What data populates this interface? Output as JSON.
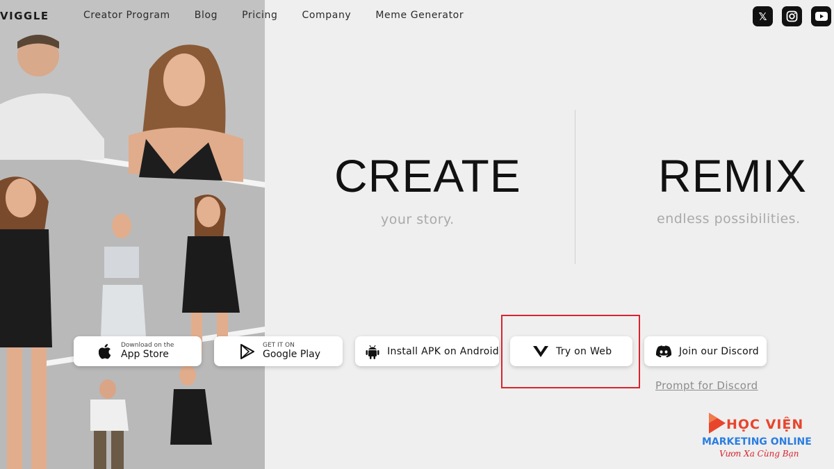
{
  "brand": {
    "logo_text": "VIGGLE"
  },
  "nav": {
    "items": [
      "Creator Program",
      "Blog",
      "Pricing",
      "Company",
      "Meme Generator"
    ]
  },
  "social": [
    {
      "icon": "x-icon",
      "glyph": "𝕏"
    },
    {
      "icon": "instagram-icon",
      "glyph": "◎"
    },
    {
      "icon": "youtube-icon",
      "glyph": "▶"
    }
  ],
  "hero": {
    "left": {
      "title": "CREATE",
      "subtitle": "your story."
    },
    "right": {
      "title": "REMIX",
      "subtitle": "endless possibilities."
    }
  },
  "buttons": {
    "appstore": {
      "small": "Download on the",
      "big": "App Store"
    },
    "gplay": {
      "small": "GET IT ON",
      "big": "Google Play"
    },
    "apk": {
      "label": "Install APK on Android"
    },
    "web": {
      "label": "Try on Web"
    },
    "discord": {
      "label": "Join our Discord"
    }
  },
  "links": {
    "prompt_discord": "Prompt for Discord"
  },
  "watermark": {
    "line1": "HỌC VIỆN",
    "line2": "MARKETING ONLINE",
    "line3": "Vươn Xa Cùng Bạn"
  },
  "colors": {
    "highlight": "#d9232d",
    "background": "#efefef",
    "collage_bg": "#bdbdbd"
  }
}
